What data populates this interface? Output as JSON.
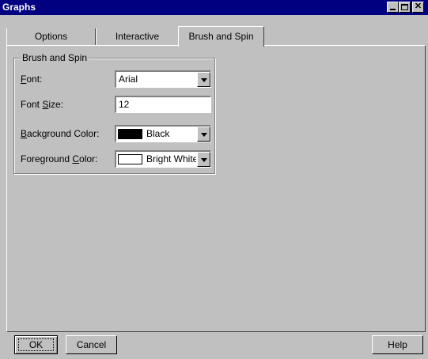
{
  "window": {
    "title": "Graphs"
  },
  "tabs": [
    {
      "label": "Options"
    },
    {
      "label": "Interactive"
    },
    {
      "label": "Brush and Spin",
      "selected": true
    }
  ],
  "group": {
    "title": "Brush and Spin",
    "font": {
      "label_pre": "",
      "label_u": "F",
      "label_post": "ont:",
      "value": "Arial"
    },
    "font_size": {
      "label_pre": "Font ",
      "label_u": "S",
      "label_post": "ize:",
      "value": "12"
    },
    "background_color": {
      "label_pre": "",
      "label_u": "B",
      "label_post": "ackground Color:",
      "value": "Black",
      "swatch": "#000000"
    },
    "foreground_color": {
      "label_pre": "Foreground ",
      "label_u": "C",
      "label_post": "olor:",
      "value": "Bright White",
      "swatch": "#ffffff"
    }
  },
  "buttons": {
    "ok": "OK",
    "cancel": "Cancel",
    "help": "Help"
  }
}
